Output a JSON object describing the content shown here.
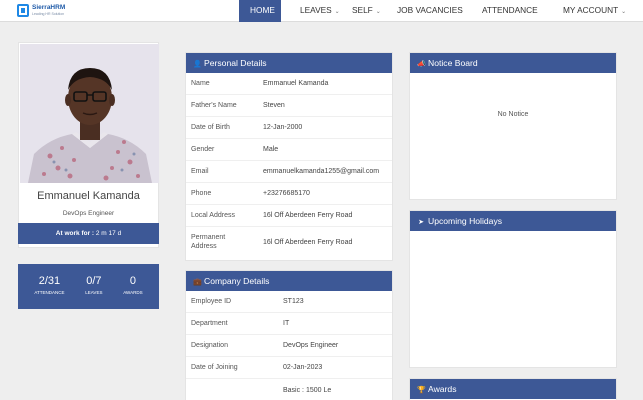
{
  "brand": {
    "name": "SierraHRM",
    "tagline": "Leading HR Solution"
  },
  "nav": {
    "items": [
      {
        "label": "HOME",
        "active": true,
        "dropdown": false
      },
      {
        "label": "LEAVES",
        "active": false,
        "dropdown": true
      },
      {
        "label": "SELF",
        "active": false,
        "dropdown": true
      },
      {
        "label": "JOB VACANCIES",
        "active": false,
        "dropdown": false
      },
      {
        "label": "ATTENDANCE",
        "active": false,
        "dropdown": false
      },
      {
        "label": "MY ACCOUNT",
        "active": false,
        "dropdown": true
      }
    ]
  },
  "profile": {
    "name": "Emmanuel Kamanda",
    "role": "DevOps Engineer",
    "at_work_label": "At work for :",
    "at_work_value": "2 m 17 d"
  },
  "stats": [
    {
      "value": "2/31",
      "label": "ATTENDANCE"
    },
    {
      "value": "0/7",
      "label": "LEAVES"
    },
    {
      "value": "0",
      "label": "AWARDS"
    }
  ],
  "personal": {
    "title": "Personal Details",
    "icon": "user-icon",
    "rows": [
      {
        "label": "Name",
        "value": "Emmanuel Kamanda"
      },
      {
        "label": "Father's Name",
        "value": "Steven"
      },
      {
        "label": "Date of Birth",
        "value": "12-Jan-2000"
      },
      {
        "label": "Gender",
        "value": "Male"
      },
      {
        "label": "Email",
        "value": "emmanuelkamanda1255@gmail.com"
      },
      {
        "label": "Phone",
        "value": "+23276685170"
      },
      {
        "label": "Local Address",
        "value": "16l Off Aberdeen Ferry Road"
      },
      {
        "label": "Permanent Address",
        "value": "16l Off Aberdeen Ferry Road"
      }
    ]
  },
  "company": {
    "title": "Company Details",
    "icon": "briefcase-icon",
    "rows": [
      {
        "label": "Employee ID",
        "value": "ST123"
      },
      {
        "label": "Department",
        "value": "IT"
      },
      {
        "label": "Designation",
        "value": "DevOps Engineer"
      },
      {
        "label": "Date of Joining",
        "value": "02-Jan-2023"
      },
      {
        "label": "",
        "value": "Basic : 1500 Le"
      }
    ]
  },
  "notice": {
    "title": "Notice Board",
    "icon": "bullhorn-icon",
    "empty_text": "No Notice"
  },
  "holidays": {
    "title": "Upcoming Holidays",
    "icon": "paper-plane-icon"
  },
  "awards": {
    "title": "Awards",
    "icon": "trophy-icon"
  },
  "colors": {
    "primary": "#3d5896",
    "background": "#eeeeee",
    "brand_blue": "#1e88e5"
  }
}
